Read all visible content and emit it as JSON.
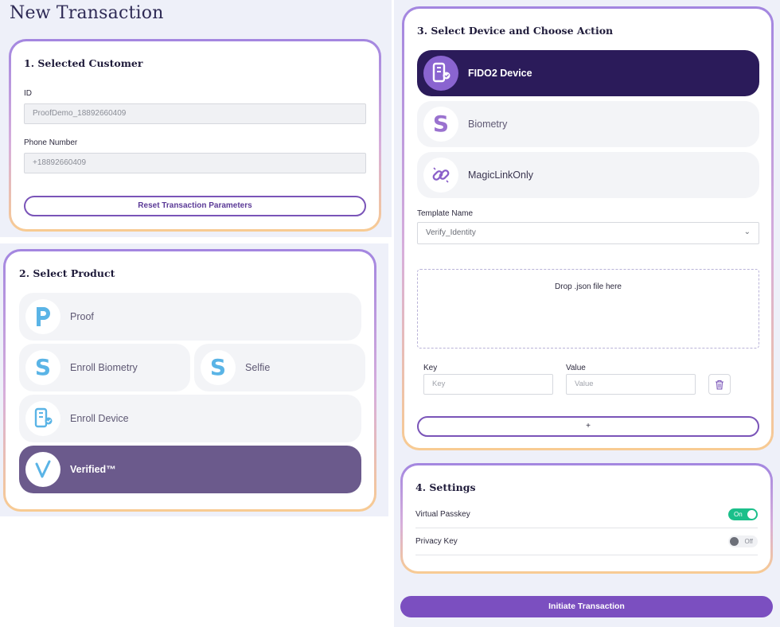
{
  "page": {
    "title": "New Transaction"
  },
  "customer": {
    "title": "1. Selected Customer",
    "id_label": "ID",
    "id_value": "ProofDemo_18892660409",
    "phone_label": "Phone Number",
    "phone_value": "+18892660409",
    "reset_label": "Reset Transaction Parameters"
  },
  "product": {
    "title": "2. Select Product",
    "options": [
      {
        "label": "Proof",
        "icon": "proof-p-icon"
      },
      {
        "label": "Enroll Biometry",
        "icon": "s-logo-icon"
      },
      {
        "label": "Selfie",
        "icon": "s-logo-icon"
      },
      {
        "label": "Enroll Device",
        "icon": "phone-device-icon"
      },
      {
        "label": "Verified™",
        "icon": "checkmark-icon",
        "selected": true
      }
    ]
  },
  "device": {
    "title": "3. Select Device and Choose Action",
    "options": [
      {
        "label": "FIDO2 Device",
        "icon": "phone-device-icon",
        "selected": true
      },
      {
        "label": "Biometry",
        "icon": "s-logo-icon"
      },
      {
        "label": "MagicLinkOnly",
        "icon": "chain-link-icon"
      }
    ],
    "template_label": "Template Name",
    "template_value": "Verify_Identity",
    "dropzone_text": "Drop .json file here",
    "key_label": "Key",
    "value_label": "Value",
    "key_placeholder": "Key",
    "value_placeholder": "Value",
    "add_label": "+"
  },
  "settings": {
    "title": "4. Settings",
    "virtual_passkey_label": "Virtual Passkey",
    "virtual_passkey_state": "On",
    "privacy_key_label": "Privacy Key",
    "privacy_key_state": "Off"
  },
  "actions": {
    "initiate_label": "Initiate Transaction"
  },
  "colors": {
    "accent": "#7b4fc0",
    "selected_product": "#6b5a8c",
    "selected_device": "#2b1b5a",
    "toggle_on": "#1bbf8a",
    "icon_blue": "#5ab4e6"
  }
}
